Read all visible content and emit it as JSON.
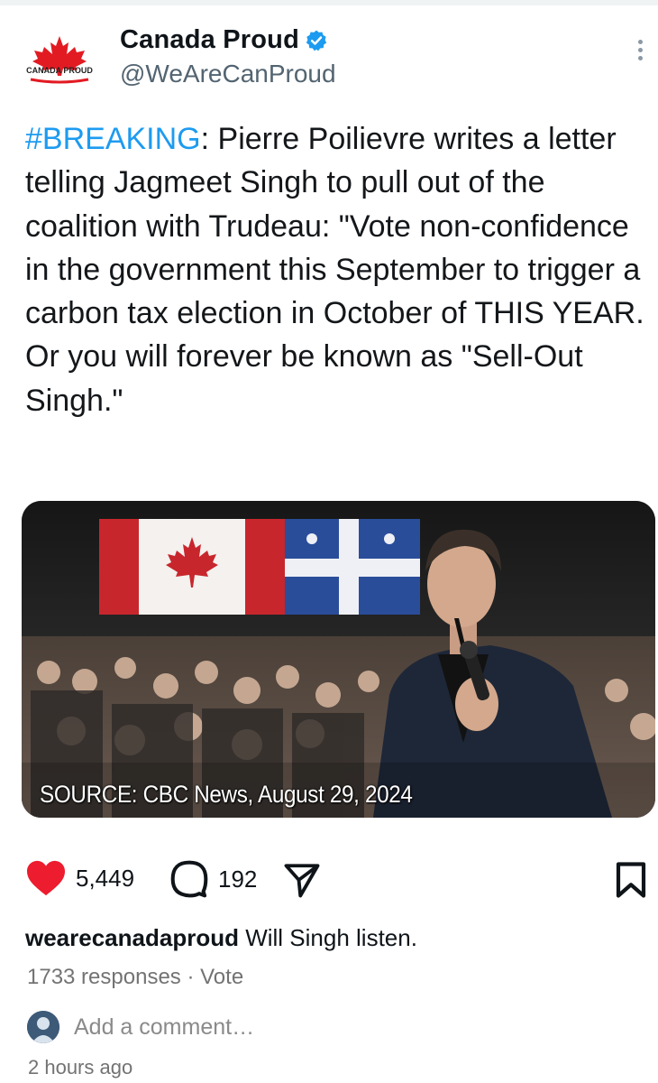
{
  "post": {
    "author": {
      "display_name": "Canada Proud",
      "handle": "@WeAreCanProud",
      "logo_text": "CANADA PROUD",
      "verified": true
    },
    "text": {
      "hashtag": "#BREAKING",
      "body": ": Pierre Poilievre writes a letter telling Jagmeet Singh to pull out of the coalition with Trudeau: \"Vote non-confidence in the government this September to trigger a carbon tax election in October of THIS YEAR. Or you will forever be known as \"Sell-Out Singh.\""
    },
    "media": {
      "caption": "SOURCE: CBC News, August 29, 2024"
    }
  },
  "actions": {
    "likes": "5,449",
    "comments": "192",
    "liked": true
  },
  "caption_comment": {
    "username": "wearecanadaproud",
    "text": "Will Singh listen."
  },
  "responses_text": "1733 responses · Vote",
  "add_comment_placeholder": "Add a comment…",
  "timestamp": "2 hours ago",
  "colors": {
    "accent": "#1d9bf0",
    "like_red": "#ed1c2e",
    "verified_blue": "#1d9bf0"
  },
  "icons": [
    "maple-leaf-logo",
    "verified-badge-icon",
    "more-options-icon",
    "heart-icon",
    "comment-bubble-icon",
    "share-icon",
    "bookmark-icon"
  ]
}
